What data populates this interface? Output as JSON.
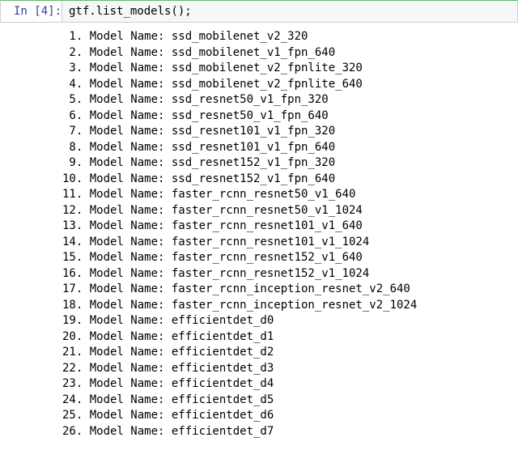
{
  "cell": {
    "prompt_prefix": "In [",
    "prompt_num": "4",
    "prompt_suffix": "]:",
    "code": "gtf.list_models();"
  },
  "output": {
    "label": "Model Name:",
    "lines": [
      {
        "n": " 1",
        "name": "ssd_mobilenet_v2_320"
      },
      {
        "n": " 2",
        "name": "ssd_mobilenet_v1_fpn_640"
      },
      {
        "n": " 3",
        "name": "ssd_mobilenet_v2_fpnlite_320"
      },
      {
        "n": " 4",
        "name": "ssd_mobilenet_v2_fpnlite_640"
      },
      {
        "n": " 5",
        "name": "ssd_resnet50_v1_fpn_320"
      },
      {
        "n": " 6",
        "name": "ssd_resnet50_v1_fpn_640"
      },
      {
        "n": " 7",
        "name": "ssd_resnet101_v1_fpn_320"
      },
      {
        "n": " 8",
        "name": "ssd_resnet101_v1_fpn_640"
      },
      {
        "n": " 9",
        "name": "ssd_resnet152_v1_fpn_320"
      },
      {
        "n": "10",
        "name": "ssd_resnet152_v1_fpn_640"
      },
      {
        "n": "11",
        "name": "faster_rcnn_resnet50_v1_640"
      },
      {
        "n": "12",
        "name": "faster_rcnn_resnet50_v1_1024"
      },
      {
        "n": "13",
        "name": "faster_rcnn_resnet101_v1_640"
      },
      {
        "n": "14",
        "name": "faster_rcnn_resnet101_v1_1024"
      },
      {
        "n": "15",
        "name": "faster_rcnn_resnet152_v1_640"
      },
      {
        "n": "16",
        "name": "faster_rcnn_resnet152_v1_1024"
      },
      {
        "n": "17",
        "name": "faster_rcnn_inception_resnet_v2_640"
      },
      {
        "n": "18",
        "name": "faster_rcnn_inception_resnet_v2_1024"
      },
      {
        "n": "19",
        "name": "efficientdet_d0"
      },
      {
        "n": "20",
        "name": "efficientdet_d1"
      },
      {
        "n": "21",
        "name": "efficientdet_d2"
      },
      {
        "n": "22",
        "name": "efficientdet_d3"
      },
      {
        "n": "23",
        "name": "efficientdet_d4"
      },
      {
        "n": "24",
        "name": "efficientdet_d5"
      },
      {
        "n": "25",
        "name": "efficientdet_d6"
      },
      {
        "n": "26",
        "name": "efficientdet_d7"
      }
    ]
  }
}
